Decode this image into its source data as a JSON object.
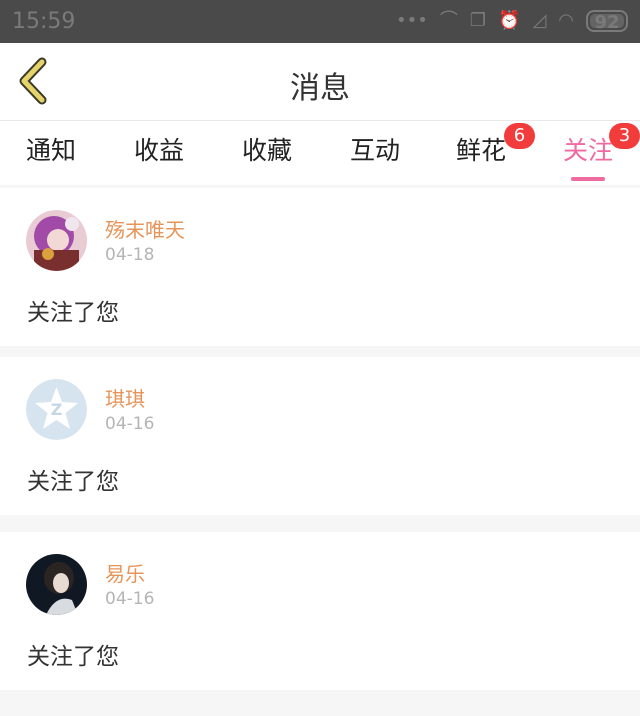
{
  "status_bar": {
    "time": "15:59",
    "battery": "92"
  },
  "header": {
    "title": "消息"
  },
  "tabs": [
    {
      "label": "通知",
      "badge": ""
    },
    {
      "label": "收益",
      "badge": ""
    },
    {
      "label": "收藏",
      "badge": ""
    },
    {
      "label": "互动",
      "badge": ""
    },
    {
      "label": "鲜花",
      "badge": "6"
    },
    {
      "label": "关注",
      "badge": "3",
      "active": true
    }
  ],
  "messages": [
    {
      "name": "殇末唯天",
      "date": "04-18",
      "text": "关注了您"
    },
    {
      "name": "琪琪",
      "date": "04-16",
      "text": "关注了您"
    },
    {
      "name": "易乐",
      "date": "04-16",
      "text": "关注了您"
    }
  ],
  "colors": {
    "accent": "#ef6aa0",
    "badge": "#f23c3c",
    "name": "#e6955a",
    "back_icon": "#e6d46a"
  }
}
